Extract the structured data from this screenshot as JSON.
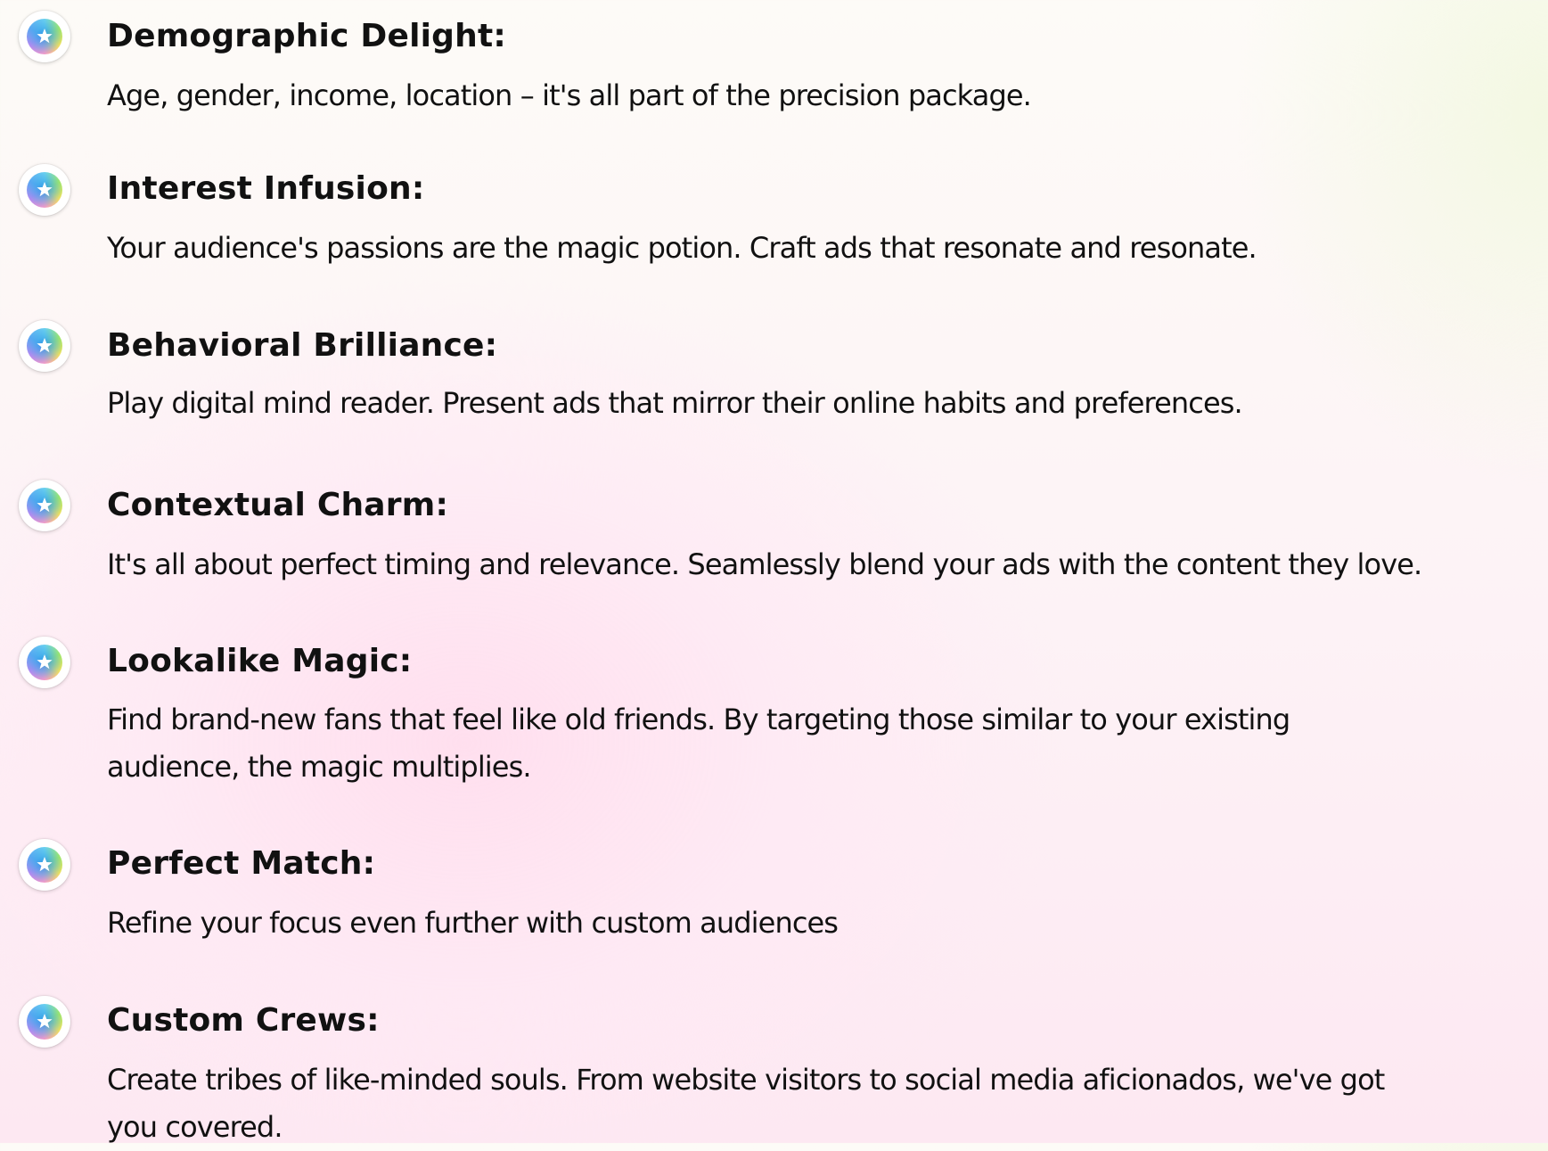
{
  "features": [
    {
      "title": "Demographic Delight:",
      "description": "Age, gender, income, location – it's all part of the precision package.",
      "icon": "star-bullet-icon"
    },
    {
      "title": "Interest Infusion:",
      "description": "Your audience's passions are the magic potion. Craft ads that resonate and resonate.",
      "icon": "star-bullet-icon"
    },
    {
      "title": "Behavioral Brilliance:",
      "description": "Play digital mind reader. Present ads that mirror their online habits and preferences.",
      "icon": "star-bullet-icon"
    },
    {
      "title": "Contextual Charm:",
      "description": "It's all about perfect timing and relevance. Seamlessly blend your ads with the content they love.",
      "icon": "star-bullet-icon"
    },
    {
      "title": "Lookalike Magic:",
      "description": "Find brand-new fans that feel like old friends. By targeting those similar to your existing audience, the magic multiplies.",
      "icon": "star-bullet-icon"
    },
    {
      "title": "Perfect Match:",
      "description": "Refine your focus even further with custom audiences",
      "icon": "star-bullet-icon"
    },
    {
      "title": "Custom Crews:",
      "description": "Create tribes of like-minded souls. From website visitors to social media aficionados, we've got you covered.",
      "icon": "star-bullet-icon"
    }
  ],
  "colors": {
    "text": "#111111",
    "bullet_ring": "#ffffff",
    "bullet_center": "#2896e6",
    "background_top": "#fdfbf7",
    "background_pink": "#fde8f2"
  }
}
